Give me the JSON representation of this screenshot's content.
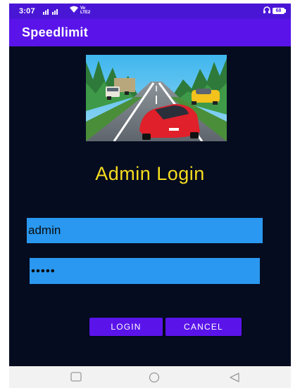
{
  "status_bar": {
    "time": "3:07",
    "lte_top": "Vo",
    "lte_bottom": "LTE2",
    "battery": "68"
  },
  "app_bar": {
    "title": "Speedlimit"
  },
  "login": {
    "title": "Admin Login",
    "username_value": "admin",
    "password_value": "•••••",
    "login_label": "LOGIN",
    "cancel_label": "CANCEL"
  },
  "colors": {
    "app_bar": "#5a14ea",
    "status_bar": "#4a16d6",
    "background": "#050c20",
    "title": "#f6dd1e",
    "field": "#2a98f0"
  },
  "icons": {
    "nav_left": "square-recents-icon",
    "nav_center": "circle-home-icon",
    "nav_right": "triangle-back-icon"
  }
}
